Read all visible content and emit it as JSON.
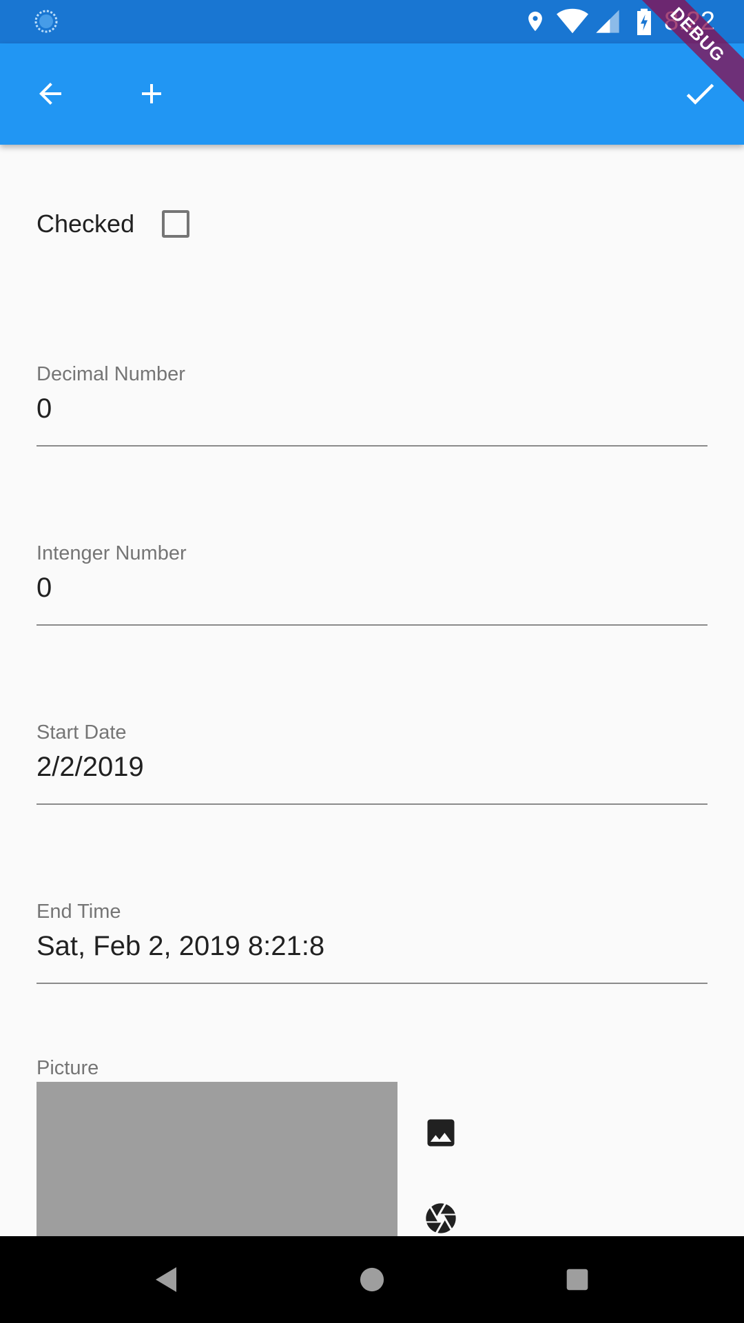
{
  "status_bar": {
    "time": "8:22",
    "background": "#1976d2"
  },
  "debug_banner": {
    "label": "DEBUG"
  },
  "app_bar": {
    "background": "#2196f3",
    "back_icon": "arrow-back-icon",
    "add_icon": "add-icon",
    "confirm_icon": "check-icon"
  },
  "form": {
    "checked": {
      "label": "Checked",
      "value": false
    },
    "decimal_number": {
      "label": "Decimal Number",
      "value": "0"
    },
    "integer_number": {
      "label": "Intenger Number",
      "value": "0"
    },
    "start_date": {
      "label": "Start Date",
      "value": "2/2/2019"
    },
    "end_time": {
      "label": "End Time",
      "value": "Sat, Feb 2, 2019 8:21:8"
    },
    "picture": {
      "label": "Picture",
      "gallery_icon": "image-icon",
      "camera_icon": "camera-shutter-icon"
    }
  },
  "nav_bar": {
    "back_icon": "nav-back-icon",
    "home_icon": "nav-home-icon",
    "recents_icon": "nav-recents-icon"
  }
}
